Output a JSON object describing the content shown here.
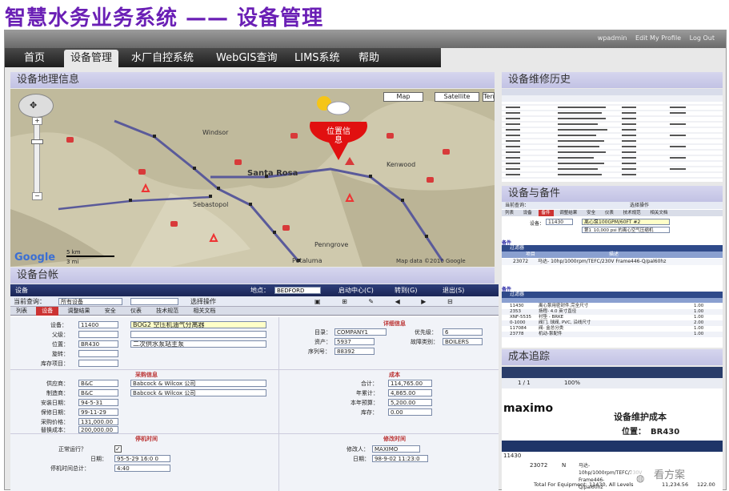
{
  "slide_title": "智慧水务业务系统 —— 设备管理",
  "toplinks": [
    "wpadmin",
    "Edit My Profile",
    "Log Out"
  ],
  "nav": [
    "首页",
    "设备管理",
    "水厂自控系统",
    "WebGIS查询",
    "LIMS系统",
    "帮助"
  ],
  "panels": {
    "map": "设备地理信息",
    "ledger": "设备台帐",
    "history": "设备维修历史",
    "parts": "设备与备件",
    "cost": "成本追踪"
  },
  "map": {
    "buttons": [
      "Map",
      "Satellite",
      "Terrain"
    ],
    "marker": "位置信息",
    "places": [
      "Windsor",
      "Santa Rosa",
      "Sebastopol",
      "Petaluma",
      "Penngrove",
      "Kenwood"
    ],
    "scale": [
      "5 km",
      "3 mi"
    ],
    "google": "Google",
    "copyright": "Map data ©2010 Google"
  },
  "ledger": {
    "bar_title": "设备",
    "site_label": "地点：",
    "site_value": "BEDFORD",
    "bar_actions": [
      "启动中心(C)",
      "转到(G)",
      "退出(S)"
    ],
    "query_label": "当前查询：",
    "query_value": "所有设备",
    "operation": "选择操作",
    "tabs": [
      "列表",
      "设备",
      "调整结果",
      "安全",
      "仪表",
      "技术规范",
      "相关文档"
    ],
    "f_device": "设备：",
    "v_device": "11400",
    "v_device_desc": "BOG2 空压机油气分离器",
    "f_parent": "父级：",
    "f_location": "位置：",
    "v_location": "BR430",
    "v_location_desc": "二次供水泵站主泵",
    "f_rotate": "旋转：",
    "f_store": "库存项目：",
    "detail_h": "详细信息",
    "f_dept": "目录：",
    "v_dept": "COMPANY1",
    "f_priority": "优先级：",
    "v_priority": "6",
    "f_asset": "资产：",
    "v_asset": "5937",
    "f_failclass": "故障类别：",
    "v_failclass": "BOILERS",
    "f_serial": "序列号：",
    "v_serial": "88392",
    "purchase_h": "采购信息",
    "f_vendor": "供应商：",
    "v_vendor": "B&C",
    "v_vendor_desc": "Babcock & Wilcox 公司",
    "f_mfr": "制造商：",
    "v_mfr": "B&C",
    "v_mfr_desc": "Babcock & Wilcox 公司",
    "f_install": "安装日期：",
    "v_install": "94-5-31",
    "f_warranty": "保修日期：",
    "v_warranty": "99-11-29",
    "f_price": "采购价格：",
    "v_price": "131,000.00",
    "f_replace": "替换成本：",
    "v_replace": "200,000.00",
    "cost_h": "成本",
    "f_total": "合计：",
    "v_total": "114,765.00",
    "f_ytd": "年累计：",
    "v_ytd": "4,865.00",
    "f_budget": "本年预算：",
    "v_budget": "5,200.00",
    "f_stock": "库存：",
    "v_stock": "0.00",
    "downtime_h": "停机时间",
    "f_running": "正常运行？",
    "f_date": "日期：",
    "v_date": "95-5-29 16:0 0",
    "f_downtotal": "停机时间总计：",
    "v_downtotal": "4:40",
    "change_h": "修改时间",
    "f_changedby": "修改人：",
    "v_changedby": "MAXIMO",
    "f_cdate": "日期：",
    "v_cdate": "98-9-02 11:23:0"
  },
  "parts": {
    "query": "当前查询：",
    "op": "选择操作",
    "tabs": [
      "列表",
      "设备",
      "备件",
      "调整结果",
      "安全",
      "仪表",
      "技术规范",
      "相关文档"
    ],
    "f_device": "设备：",
    "v_device": "11430",
    "v_desc": "离心泵100GPM/60FT #2",
    "v_desc2": "第1_10,000 psi 的离心空气压缩机",
    "sec1": "备件",
    "filter": "过滤器",
    "rows1_head": [
      "项目",
      "描述"
    ],
    "row1": [
      "23072",
      "马达- 10hp/1000rpm/TEFC/230V Frame446-Q/pal60hz"
    ],
    "sec2": "备件",
    "rows2": [
      [
        "11430",
        "离心泵用密封件,完全尺寸",
        "1.00"
      ],
      [
        "2353",
        "扬程- 4.0 英寸直径",
        "1.00"
      ],
      [
        "XNF-5535",
        "衬垫 - BRKE",
        "1.00"
      ],
      [
        "0-1000",
        "阀门, 球阀, PVC, 沿线尺寸",
        "2.00"
      ],
      [
        "117084",
        "阀- 金总分类",
        "1.00"
      ],
      [
        "23778",
        "机动-泵配件",
        "1.00"
      ]
    ]
  },
  "cost": {
    "pager": "1 / 1",
    "zoom": "100%",
    "brand": "maximo",
    "title": "设备维护成本",
    "loc_label": "位置：",
    "loc_value": "BR430",
    "row_item": "11430",
    "row_part": "23072",
    "row_flag": "N",
    "row_desc": "马达- 10hp/1000rpm/TEFC/230V Frame446-Q/pal60hz",
    "total": "Total For Equipment: 11430, All Levels",
    "total_v": "11,234.56",
    "total_v2": "122.00",
    "watermark": "看方案"
  }
}
